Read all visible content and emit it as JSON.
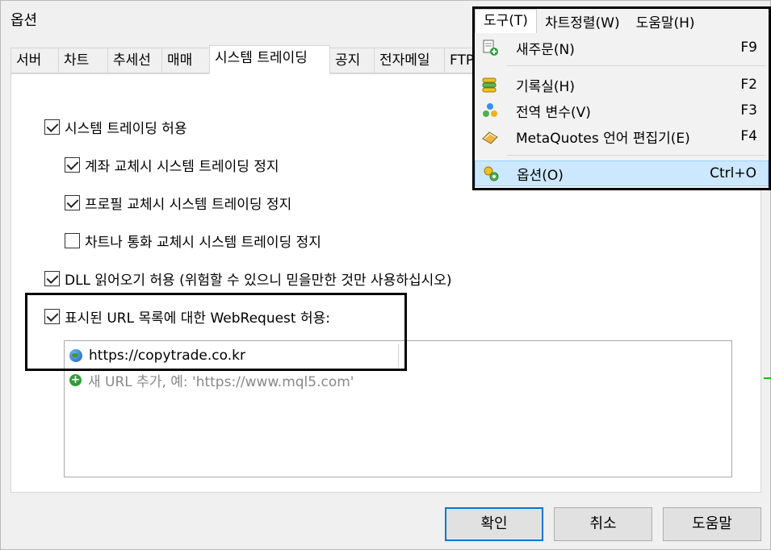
{
  "window": {
    "title": "옵션"
  },
  "tabs": [
    "서버",
    "차트",
    "추세선",
    "매매",
    "시스템 트레이딩",
    "공지",
    "전자메일",
    "FTP"
  ],
  "active_tab": "시스템 트레이딩",
  "options": {
    "allow_algo": {
      "label": "시스템 트레이딩 허용",
      "checked": true
    },
    "stop_on_account": {
      "label": "계좌 교체시 시스템 트레이딩 정지",
      "checked": true
    },
    "stop_on_profile": {
      "label": "프로필 교체시 시스템 트레이딩 정지",
      "checked": true
    },
    "stop_on_chart": {
      "label": "차트나 통화 교체시 시스템 트레이딩 정지",
      "checked": false
    },
    "allow_dll": {
      "label": "DLL 읽어오기 허용 (위험할 수 있으니 믿을만한 것만 사용하십시오)",
      "checked": true
    },
    "allow_webrequest": {
      "label": "표시된 URL 목록에 대한 WebRequest 허용:",
      "checked": true
    }
  },
  "url_list": {
    "items": [
      "https://copytrade.co.kr"
    ],
    "add_placeholder": "새 URL 추가, 예: 'https://www.mql5.com'"
  },
  "buttons": {
    "ok": "확인",
    "cancel": "취소",
    "help": "도움말"
  },
  "menubar": {
    "tools": "도구(T)",
    "charts": "차트정렬(W)",
    "help": "도움말(H)"
  },
  "tools_menu": [
    {
      "label": "새주문(N)",
      "shortcut": "F9",
      "icon": "new-order-icon"
    },
    {
      "label": "기록실(H)",
      "shortcut": "F2",
      "icon": "history-center-icon"
    },
    {
      "label": "전역 변수(V)",
      "shortcut": "F3",
      "icon": "global-variables-icon"
    },
    {
      "label": "MetaQuotes 언어 편집기(E)",
      "shortcut": "F4",
      "icon": "metaeditor-icon"
    },
    {
      "label": "옵션(O)",
      "shortcut": "Ctrl+O",
      "icon": "options-icon"
    }
  ]
}
